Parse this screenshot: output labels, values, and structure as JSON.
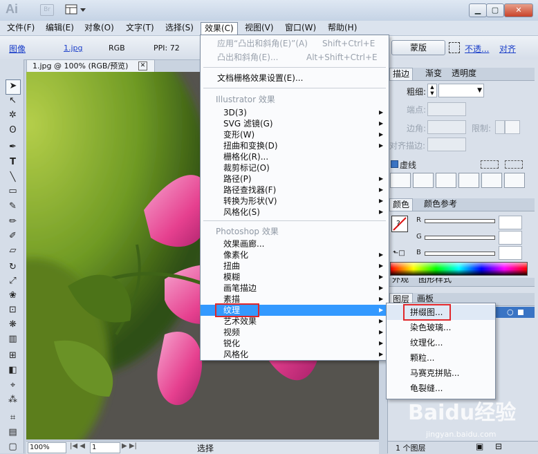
{
  "titlebar": {
    "app_logo": "Ai",
    "bridge_badge": "Br",
    "window_buttons": [
      "minimize",
      "restore",
      "close"
    ]
  },
  "menubar": [
    {
      "label": "文件(F)"
    },
    {
      "label": "编辑(E)"
    },
    {
      "label": "对象(O)"
    },
    {
      "label": "文字(T)"
    },
    {
      "label": "选择(S)"
    },
    {
      "label": "效果(C)",
      "active": true
    },
    {
      "label": "视图(V)"
    },
    {
      "label": "窗口(W)"
    },
    {
      "label": "帮助(H)"
    }
  ],
  "controlbar": {
    "object_type": "图像",
    "filename": "1.jpg",
    "color_mode": "RGB",
    "ppi": "PPI: 72",
    "mask_button": "蒙版",
    "opacity_link": "不透...",
    "align_link": "对齐"
  },
  "document": {
    "tab_title": "1.jpg @ 100% (RGB/预览)",
    "zoom": "100%",
    "artboard_number": "1",
    "status_text": "选择"
  },
  "effects_menu": {
    "top_items": [
      {
        "label": "应用“凸出和斜角(E)”(A)",
        "shortcut": "Shift+Ctrl+E",
        "disabled": true
      },
      {
        "label": "凸出和斜角(E)...",
        "shortcut": "Alt+Shift+Ctrl+E",
        "disabled": true
      }
    ],
    "doc_raster_settings": "文档栅格效果设置(E)...",
    "illustrator_heading": "Illustrator 效果",
    "illustrator_items": [
      {
        "label": "3D(3)",
        "submenu": true
      },
      {
        "label": "SVG 滤镜(G)",
        "submenu": true
      },
      {
        "label": "变形(W)",
        "submenu": true
      },
      {
        "label": "扭曲和变换(D)",
        "submenu": true
      },
      {
        "label": "栅格化(R)...",
        "submenu": false
      },
      {
        "label": "裁剪标记(O)",
        "submenu": false
      },
      {
        "label": "路径(P)",
        "submenu": true
      },
      {
        "label": "路径查找器(F)",
        "submenu": true
      },
      {
        "label": "转换为形状(V)",
        "submenu": true
      },
      {
        "label": "风格化(S)",
        "submenu": true
      }
    ],
    "photoshop_heading": "Photoshop 效果",
    "photoshop_items": [
      {
        "label": "效果画廊...",
        "submenu": false
      },
      {
        "label": "像素化",
        "submenu": true
      },
      {
        "label": "扭曲",
        "submenu": true
      },
      {
        "label": "模糊",
        "submenu": true
      },
      {
        "label": "画笔描边",
        "submenu": true
      },
      {
        "label": "素描",
        "submenu": true
      },
      {
        "label": "纹理",
        "submenu": true,
        "highlighted": true
      },
      {
        "label": "艺术效果",
        "submenu": true
      },
      {
        "label": "视频",
        "submenu": true
      },
      {
        "label": "锐化",
        "submenu": true
      },
      {
        "label": "风格化",
        "submenu": true
      }
    ]
  },
  "texture_submenu": [
    {
      "label": "拼缀图...",
      "highlighted": true
    },
    {
      "label": "染色玻璃..."
    },
    {
      "label": "纹理化..."
    },
    {
      "label": "颗粒..."
    },
    {
      "label": "马赛克拼贴..."
    },
    {
      "label": "龟裂缝..."
    }
  ],
  "stroke_panel": {
    "tabs": [
      "描边",
      "渐变",
      "透明度"
    ],
    "weight_label": "粗细:",
    "cap_label": "端点:",
    "corner_label": "边角:",
    "limit_label": "限制:",
    "align_label": "对齐描边:",
    "dashed_label": "虚线"
  },
  "color_panel": {
    "tabs": [
      "颜色",
      "颜色参考"
    ],
    "channels": [
      "R",
      "G",
      "B"
    ]
  },
  "partial_tabs": [
    "外观",
    "图形样式"
  ],
  "layers_panel": {
    "tabs": [
      "图层",
      "画板"
    ],
    "status": "1 个图层"
  },
  "watermark": {
    "brand": "Baidu经验",
    "url": "jingyan.baidu.com"
  }
}
